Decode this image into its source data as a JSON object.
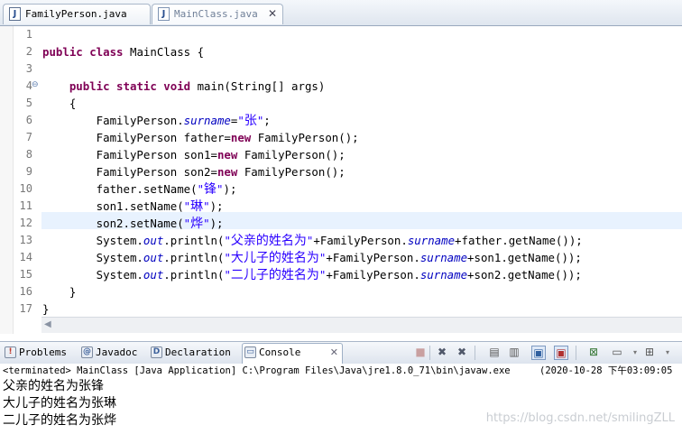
{
  "editor_tabs": [
    {
      "label": "FamilyPerson.java",
      "icon": "java-file-icon"
    },
    {
      "label": "MainClass.java",
      "icon": "java-file-icon",
      "close": "✕"
    }
  ],
  "code": {
    "line_numbers": [
      "1",
      "2",
      "3",
      "4",
      "5",
      "6",
      "7",
      "8",
      "9",
      "10",
      "11",
      "12",
      "13",
      "14",
      "15",
      "16",
      "17"
    ],
    "fold_marker": "⊖"
  },
  "views": {
    "problems": "Problems",
    "javadoc": "Javadoc",
    "declaration": "Declaration",
    "console": "Console",
    "console_close": "✕"
  },
  "console": {
    "terminated": "<terminated> MainClass [Java Application] C:\\Program Files\\Java\\jre1.8.0_71\\bin\\javaw.exe",
    "timestamp": "(2020-10-28 下午03:09:05",
    "output": [
      "父亲的姓名为张锋",
      "大儿子的姓名为张琳",
      "二儿子的姓名为张烨"
    ]
  },
  "watermark": "https://blog.csdn.net/smilingZLL",
  "colors": {
    "keyword": "#7f0055",
    "static_field": "#0000c0",
    "string": "#2a00ff",
    "current_line": "#e8f2fe"
  }
}
